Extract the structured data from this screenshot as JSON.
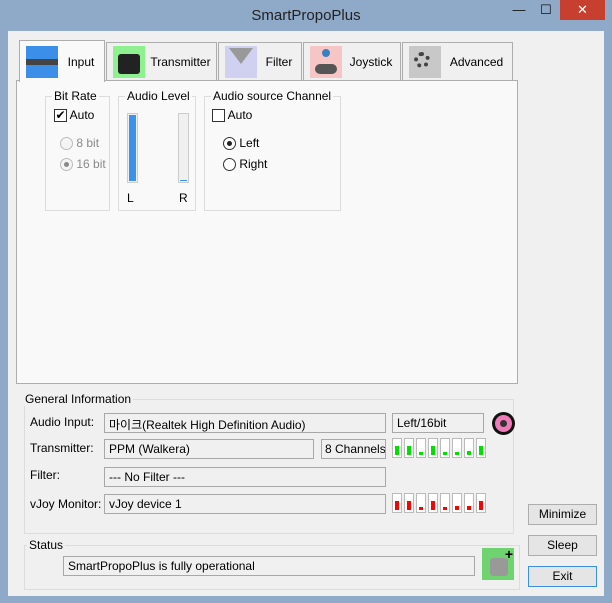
{
  "window": {
    "title": "SmartPropoPlus",
    "minimize": "—",
    "maximize": "☐",
    "close": "✕"
  },
  "tabs": [
    {
      "label": "Input",
      "icon": "audio-jack-icon"
    },
    {
      "label": "Transmitter",
      "icon": "transmitter-icon"
    },
    {
      "label": "Filter",
      "icon": "funnel-icon"
    },
    {
      "label": "Joystick",
      "icon": "joystick-icon"
    },
    {
      "label": "Advanced",
      "icon": "gears-icon"
    }
  ],
  "input": {
    "bit_rate": {
      "title": "Bit Rate",
      "auto_label": "Auto",
      "auto_checked": true,
      "options": [
        "8 bit",
        "16 bit"
      ],
      "selected": "16 bit"
    },
    "audio_level": {
      "title": "Audio Level",
      "left_label": "L",
      "right_label": "R",
      "left_level": 1.0,
      "right_level": 0.02
    },
    "channel": {
      "title": "Audio source Channel",
      "auto_label": "Auto",
      "auto_checked": false,
      "options": [
        "Left",
        "Right"
      ],
      "selected": "Left"
    }
  },
  "general": {
    "title": "General Information",
    "audio_input_label": "Audio Input:",
    "audio_input": "마이크(Realtek High Definition Audio)",
    "audio_format": "Left/16bit",
    "transmitter_label": "Transmitter:",
    "transmitter": "PPM (Walkera)",
    "channels": "8 Channels",
    "filter_label": "Filter:",
    "filter": "--- No Filter ---",
    "vjoy_label": "vJoy Monitor:",
    "vjoy": "vJoy device 1",
    "transmitter_levels": [
      0.55,
      0.55,
      0.2,
      0.55,
      0.2,
      0.2,
      0.25,
      0.55
    ],
    "vjoy_levels": [
      0.55,
      0.55,
      0.2,
      0.55,
      0.2,
      0.25,
      0.25,
      0.55
    ],
    "colors": {
      "transmitter": "#00e000",
      "vjoy": "#ff0000"
    }
  },
  "status": {
    "title": "Status",
    "text": "SmartPropoPlus is fully operational"
  },
  "buttons": {
    "minimize": "Minimize",
    "sleep": "Sleep",
    "exit": "Exit"
  }
}
